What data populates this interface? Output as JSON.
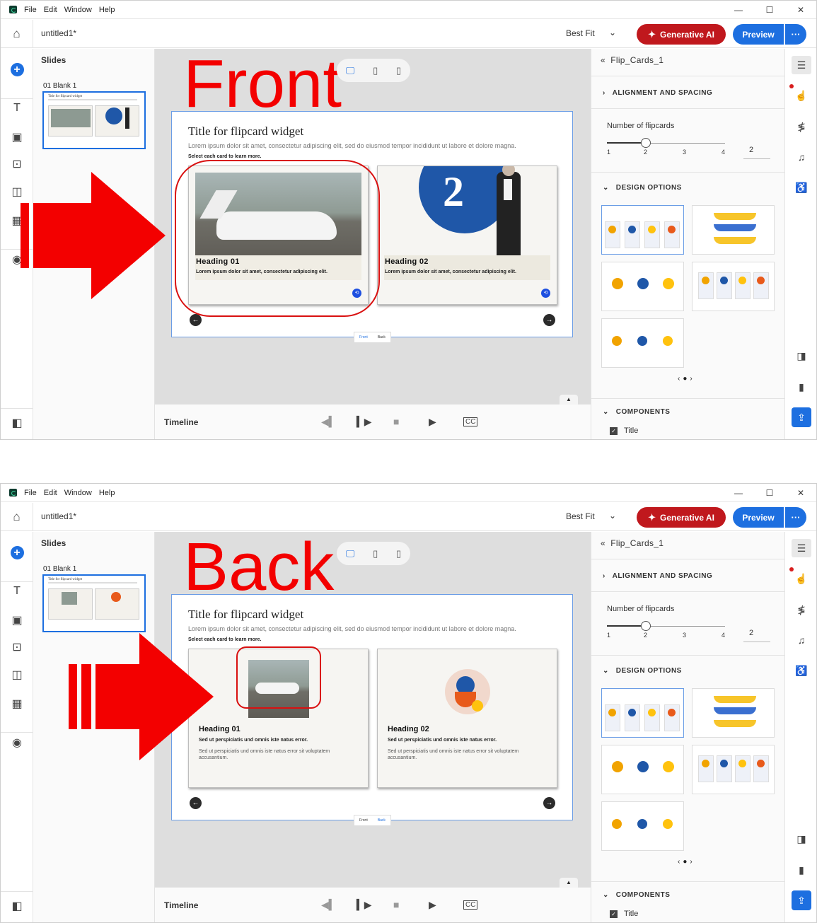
{
  "menu": [
    "File",
    "Edit",
    "Window",
    "Help"
  ],
  "window_controls": [
    "—",
    "☐",
    "✕"
  ],
  "toolbar": {
    "doc_title": "untitled1*",
    "fit": "Best Fit",
    "genai_label": "Generative AI",
    "preview_label": "Preview",
    "more_label": "···"
  },
  "slides_panel": {
    "title": "Slides",
    "slide_label": "01  Blank 1"
  },
  "front": {
    "big_label": "Front",
    "slide_title": "Title for flipcard widget",
    "slide_body": "Lorem ipsum dolor sit amet, consectetur adipiscing elit, sed do eiusmod tempor incididunt ut labore et dolore magna.",
    "slide_instruction": "Select each card to learn more.",
    "card1": {
      "heading": "Heading 01",
      "text": "Lorem ipsum dolor sit amet, consectetur adipiscing elit."
    },
    "card2": {
      "heading": "Heading 02",
      "text": "Lorem ipsum dolor sit amet, consectetur adipiscing elit.",
      "number": "2"
    }
  },
  "back": {
    "big_label": "Back",
    "slide_title": "Title for flipcard widget",
    "slide_body": "Lorem ipsum dolor sit amet, consectetur adipiscing elit, sed do eiusmod tempor incididunt ut labore et dolore magna.",
    "slide_instruction": "Select each card to learn more.",
    "card1": {
      "heading": "Heading 01",
      "subtext": "Sed ut perspiciatis und omnis iste natus error.",
      "body": "Sed ut perspiciatis und omnis iste natus error sit voluptatem accusantium."
    },
    "card2": {
      "heading": "Heading 02",
      "subtext": "Sed ut perspiciatis und omnis iste natus error.",
      "body": "Sed ut perspiciatis und omnis iste natus error sit voluptatem accusantium."
    }
  },
  "toggle": {
    "front": "Front",
    "back": "Back"
  },
  "timeline": {
    "label": "Timeline"
  },
  "properties": {
    "header": "Flip_Cards_1",
    "alignment": "ALIGNMENT AND SPACING",
    "num_flipcards_label": "Number of flipcards",
    "ticks": [
      "1",
      "2",
      "3",
      "4"
    ],
    "num_value": "2",
    "selected_fraction": 0.333,
    "design_options": "DESIGN OPTIONS",
    "components": "COMPONENTS",
    "component_title": "Title"
  },
  "colors": {
    "accent": "#1d6fe0",
    "genai": "#c0181d",
    "annotation_red": "#f30000"
  }
}
